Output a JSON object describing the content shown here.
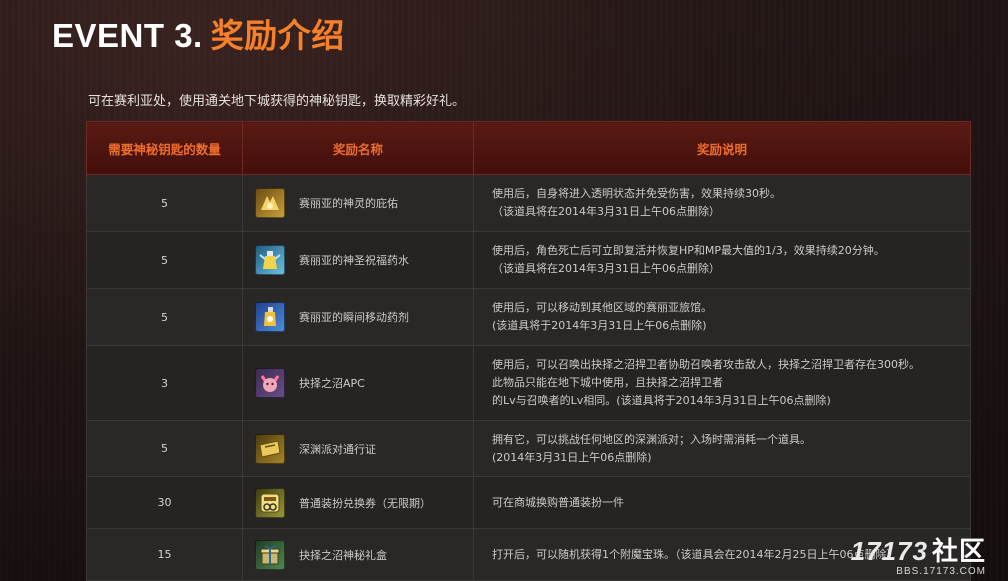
{
  "header": {
    "title_en": "EVENT 3.",
    "title_zh": "奖励介绍"
  },
  "intro": "可在赛利亚处，使用通关地下城获得的神秘钥匙，换取精彩好礼。",
  "table": {
    "columns": [
      "需要神秘钥匙的数量",
      "奖励名称",
      "奖励说明"
    ],
    "rows": [
      {
        "qty": "5",
        "name": "赛丽亚的神灵的庇佑",
        "icon": "golden-wing-icon",
        "desc": [
          "使用后，自身将进入透明状态并免受伤害，效果持续30秒。",
          "（该道具将在2014年3月31日上午06点删除）"
        ]
      },
      {
        "qty": "5",
        "name": "赛丽亚的神圣祝福药水",
        "icon": "blessing-potion-icon",
        "desc": [
          "使用后，角色死亡后可立即复活并恢复HP和MP最大值的1/3，效果持续20分钟。",
          "（该道具将在2014年3月31日上午06点删除）"
        ]
      },
      {
        "qty": "5",
        "name": "赛丽亚的瞬间移动药剂",
        "icon": "teleport-potion-icon",
        "desc": [
          "使用后，可以移动到其他区域的赛丽亚旅馆。",
          "(该道具将于2014年3月31日上午06点删除)"
        ]
      },
      {
        "qty": "3",
        "name": "抉择之沼APC",
        "icon": "apc-portrait-icon",
        "desc": [
          "使用后，可以召唤出抉择之沼捍卫者协助召唤者攻击敌人，抉择之沼捍卫者存在300秒。",
          "此物品只能在地下城中使用，且抉择之沼捍卫者",
          "的Lv与召唤者的Lv相同。(该道具将于2014年3月31日上午06点删除)"
        ]
      },
      {
        "qty": "5",
        "name": "深渊派对通行证",
        "icon": "ticket-icon",
        "desc": [
          "拥有它，可以挑战任何地区的深渊派对；入场时需消耗一个道具。",
          "(2014年3月31日上午06点删除)"
        ]
      },
      {
        "qty": "30",
        "name": "普通装扮兑换券（无限期）",
        "icon": "avatar-coupon-icon",
        "desc": [
          "可在商城换购普通装扮一件"
        ]
      },
      {
        "qty": "15",
        "name": "抉择之沼神秘礼盒",
        "icon": "mystery-box-icon",
        "desc": [
          "打开后，可以随机获得1个附魔宝珠。（该道具会在2014年2月25日上午06点删除）"
        ]
      }
    ]
  },
  "watermark": {
    "logo_num": "17173",
    "logo_text": "社区",
    "url": "BBS.17173.COM"
  }
}
